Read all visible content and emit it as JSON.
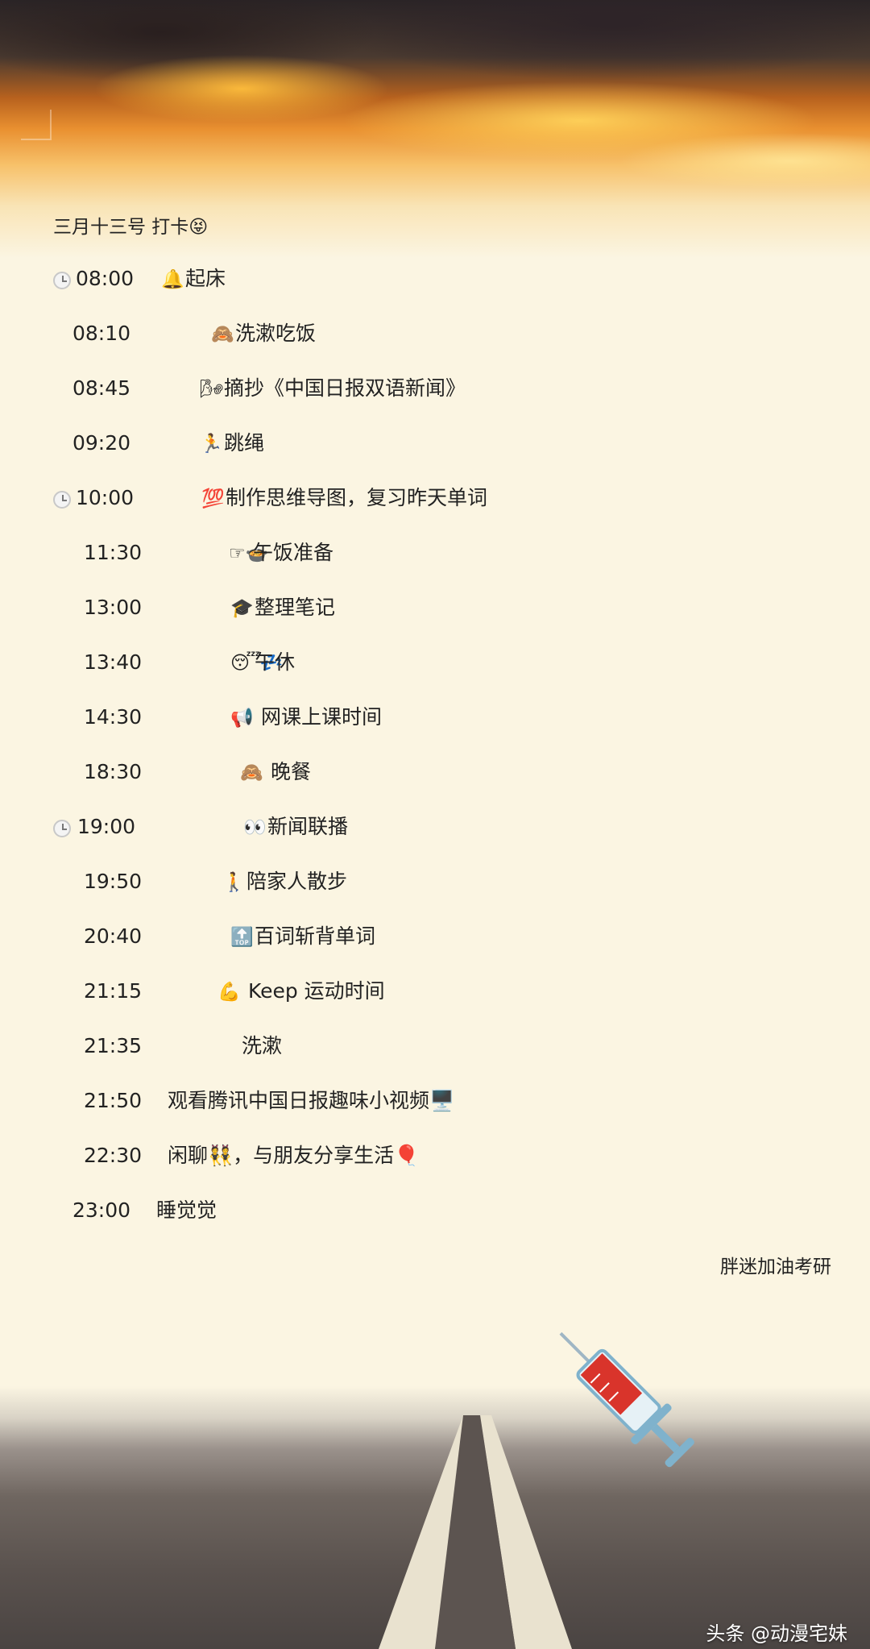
{
  "title": "三月十三号    打卡😝",
  "schedule": [
    {
      "time": "08:00",
      "icon": "bell-icon",
      "emoji": "🔔",
      "task": "起床",
      "clock": true
    },
    {
      "time": "08:10",
      "icon": "see-no-evil-monkey-icon",
      "emoji": "🙈",
      "task": "洗漱吃饭",
      "clock": false
    },
    {
      "time": "08:45",
      "icon": "wind-icon",
      "emoji": "🌬",
      "task": "摘抄《中国日报双语新闻》",
      "clock": false
    },
    {
      "time": "09:20",
      "icon": "runner-icon",
      "emoji": "🏃",
      "task": "跳绳",
      "clock": false
    },
    {
      "time": "10:00",
      "icon": "hundred-points-icon",
      "emoji": "💯",
      "task": "制作思维导图，复习昨天单词",
      "clock": true
    },
    {
      "time": "11:30",
      "icon": "pointing-bowl-icon",
      "emoji": "☞🍲",
      "task": "午饭准备",
      "clock": false
    },
    {
      "time": "13:00",
      "icon": "graduation-cap-icon",
      "emoji": "🎓",
      "task": "整理笔记",
      "clock": false
    },
    {
      "time": "13:40",
      "icon": "sleeping-face-icon",
      "emoji": "😴💤",
      "task": "午休",
      "clock": false
    },
    {
      "time": "14:30",
      "icon": "megaphone-icon",
      "emoji": "📢",
      "task": " 网课上课时间",
      "clock": false
    },
    {
      "time": "18:30",
      "icon": "see-no-evil-monkey-icon",
      "emoji": "🙈",
      "task": " 晚餐",
      "clock": false
    },
    {
      "time": "19:00",
      "icon": "eyes-icon",
      "emoji": "👀",
      "task": "新闻联播",
      "clock": true
    },
    {
      "time": "19:50",
      "icon": "walking-person-icon",
      "emoji": "🚶",
      "task": "陪家人散步",
      "clock": false
    },
    {
      "time": "20:40",
      "icon": "top-arrow-icon",
      "emoji": "🔝",
      "task": "百词斩背单词",
      "clock": false
    },
    {
      "time": "21:15",
      "icon": "flexed-biceps-icon",
      "emoji": "💪",
      "task": "  Keep 运动时间",
      "clock": false
    },
    {
      "time": "21:35",
      "icon": "",
      "emoji": "",
      "task": "洗漱",
      "clock": false
    },
    {
      "time": "21:50",
      "icon": "",
      "emoji": "",
      "task": "观看腾讯中国日报趣味小视频🖥️",
      "clock": false
    },
    {
      "time": "22:30",
      "icon": "",
      "emoji": "",
      "task": "闲聊👯，与朋友分享生活🎈",
      "clock": false
    },
    {
      "time": "23:00",
      "icon": "",
      "emoji": "",
      "task": "睡觉觉",
      "clock": false
    }
  ],
  "signoff": "胖迷加油考研",
  "watermark": "头条 @动漫宅妹",
  "colors": {
    "background": "#fbf5e2",
    "sunset": "#e99030",
    "syringe": "#d9342b"
  }
}
